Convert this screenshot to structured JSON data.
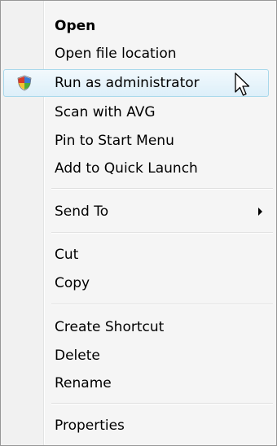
{
  "menu": {
    "items": [
      {
        "label": "Open"
      },
      {
        "label": "Open file location"
      },
      {
        "label": "Run as administrator"
      },
      {
        "label": "Scan with AVG"
      },
      {
        "label": "Pin to Start Menu"
      },
      {
        "label": "Add to Quick Launch"
      },
      {
        "label": "Send To"
      },
      {
        "label": "Cut"
      },
      {
        "label": "Copy"
      },
      {
        "label": "Create Shortcut"
      },
      {
        "label": "Delete"
      },
      {
        "label": "Rename"
      },
      {
        "label": "Properties"
      }
    ],
    "icons": {
      "run_as_admin": "uac-shield-icon",
      "send_to": "submenu-arrow-icon",
      "pointer": "mouse-cursor-icon"
    },
    "colors": {
      "highlight_border": "#a8d8eb",
      "highlight_fill": "#ddeff9",
      "menu_background": "#f5f5f5"
    }
  }
}
